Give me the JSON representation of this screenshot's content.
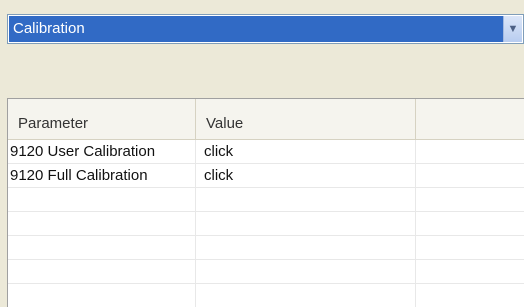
{
  "section_dropdown": {
    "value": "Calibration",
    "arrow": "chevron-down-icon"
  },
  "grid": {
    "headers": [
      "Parameter",
      "Value",
      ""
    ],
    "rows": [
      [
        "9120 User Calibration",
        "click",
        ""
      ],
      [
        "9120 Full Calibration",
        "click",
        ""
      ],
      [
        "",
        "",
        ""
      ],
      [
        "",
        "",
        ""
      ],
      [
        "",
        "",
        ""
      ],
      [
        "",
        "",
        ""
      ],
      [
        "",
        "",
        ""
      ]
    ]
  },
  "colors": {
    "selection": "#316ac5",
    "panel": "#ece9d8"
  }
}
